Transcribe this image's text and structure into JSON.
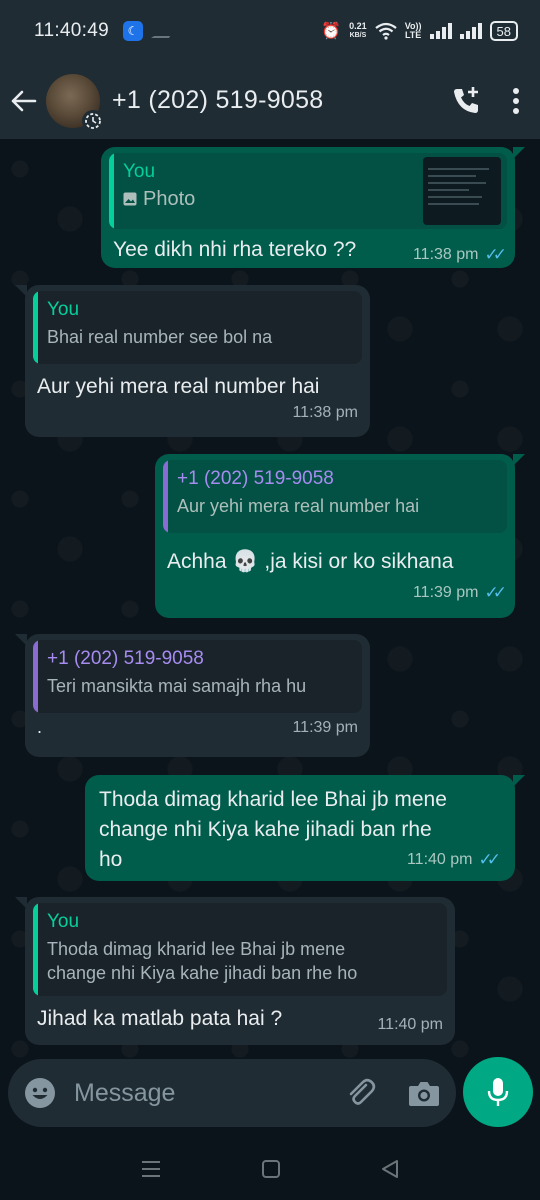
{
  "status_bar": {
    "time": "11:40:49",
    "data_speed": "0.21",
    "data_unit": "KB/S",
    "network_top": "Vo))",
    "network_bottom": "LTE",
    "battery": "58"
  },
  "header": {
    "contact_name": "+1 (202) 519-9058"
  },
  "messages": [
    {
      "direction": "out",
      "quote_author": "You",
      "quote_text": "Photo",
      "text": "Yee dikh nhi rha tereko ??",
      "time": "11:38 pm"
    },
    {
      "direction": "in",
      "quote_author": "You",
      "quote_text": "Bhai real number see bol na",
      "text": "Aur yehi mera real number hai",
      "time": "11:38 pm"
    },
    {
      "direction": "out",
      "quote_author": "+1 (202) 519-9058",
      "quote_text": "Aur yehi mera real number hai",
      "text": "Achha 💀 ,ja kisi or ko sikhana",
      "time": "11:39 pm"
    },
    {
      "direction": "in",
      "quote_author": "+1 (202) 519-9058",
      "quote_text": "Teri mansikta mai samajh rha hu",
      "text": ".",
      "time": "11:39 pm"
    },
    {
      "direction": "out",
      "text_line1": "Thoda dimag kharid lee Bhai jb mene",
      "text_line2": "change nhi Kiya kahe jihadi ban rhe",
      "text_line3": "ho",
      "time": "11:40 pm"
    },
    {
      "direction": "in",
      "quote_author": "You",
      "quote_text_line1": "Thoda dimag kharid lee Bhai jb mene",
      "quote_text_line2": "change nhi Kiya kahe jihadi ban rhe ho",
      "text": "Jihad ka matlab pata hai ?",
      "time": "11:40 pm"
    }
  ],
  "composer": {
    "placeholder": "Message"
  },
  "colors": {
    "outgoing_bubble": "#005c4b",
    "incoming_bubble": "#202c33",
    "accent_green": "#00a884",
    "read_ticks": "#53bdeb"
  }
}
